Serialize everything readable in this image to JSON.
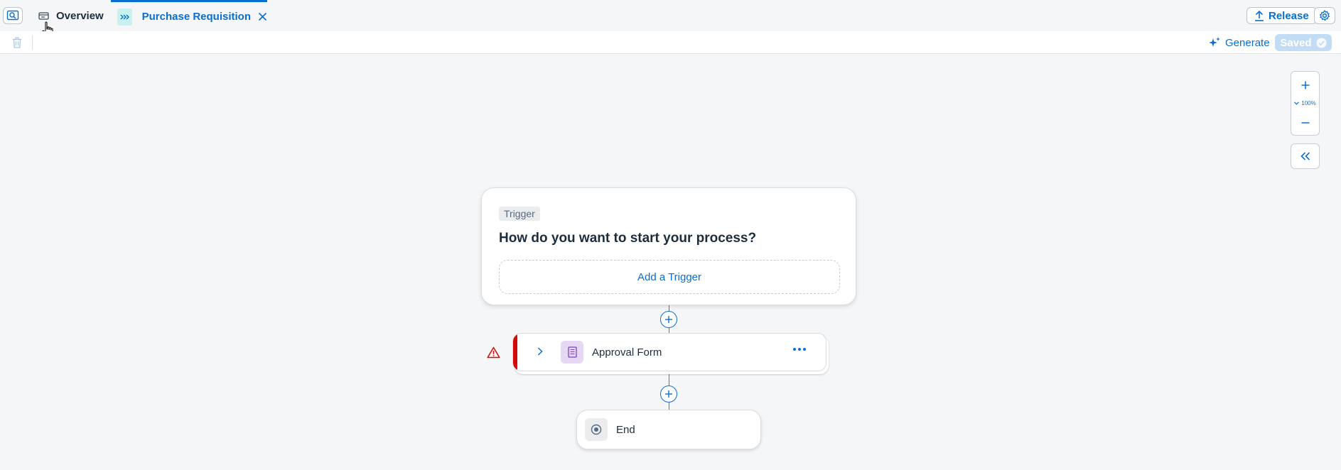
{
  "tabs": [
    {
      "label": "Overview",
      "icon": "folder-icon"
    },
    {
      "label": "Purchase Requisition",
      "icon": "process-icon"
    }
  ],
  "header": {
    "release_label": "Release"
  },
  "toolbar": {
    "generate_label": "Generate",
    "saved_label": "Saved"
  },
  "zoom": {
    "level": "100%"
  },
  "flow": {
    "trigger": {
      "tag": "Trigger",
      "question": "How do you want to start your process?",
      "add_label": "Add a Trigger"
    },
    "steps": [
      {
        "label": "Approval Form",
        "icon": "form-icon",
        "status": "error"
      }
    ],
    "end": {
      "label": "End"
    }
  },
  "colors": {
    "accent": "#0a6ed1",
    "error": "#d20a0a",
    "process_icon_bg": "#c8f2f2",
    "form_icon_bg": "#e6d7f5",
    "saved_bg": "#c2dcf5"
  }
}
